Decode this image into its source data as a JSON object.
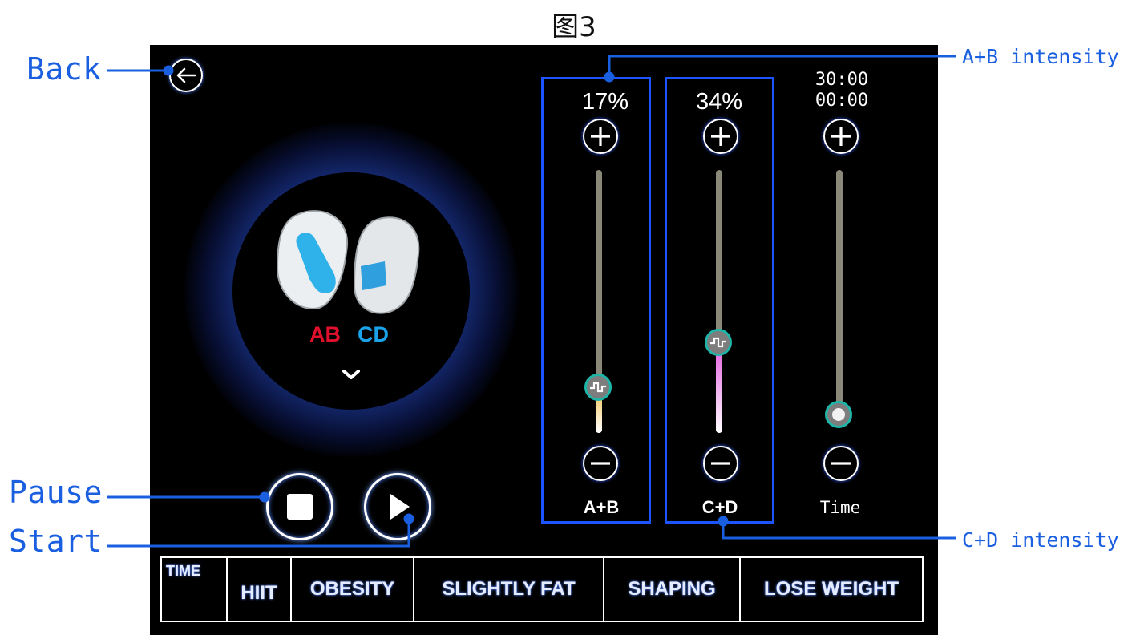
{
  "figure": {
    "title": "图3"
  },
  "annotations": {
    "back": "Back",
    "pause": "Pause",
    "start": "Start",
    "ab_intensity": "A+B intensity",
    "cd_intensity": "C+D intensity",
    "color": "#1a5fe0"
  },
  "screen": {
    "channels": {
      "ab_label": "AB",
      "cd_label": "CD",
      "ab_color": "#e0102c",
      "cd_color": "#1ba3ea"
    },
    "sliders": [
      {
        "id": "ab",
        "label": "A+B",
        "value_text": "17%",
        "value": 0.17,
        "fill_color": "#f0c050"
      },
      {
        "id": "cd",
        "label": "C+D",
        "value_text": "34%",
        "value": 0.34,
        "fill_color": "#e25ce0"
      },
      {
        "id": "time",
        "label": "Time",
        "time_total": "30:00",
        "time_elapsed": "00:00",
        "value": 0.0
      }
    ],
    "programs": [
      "TIME",
      "HIIT",
      "OBESITY",
      "SLIGHTLY FAT",
      "SHAPING",
      "LOSE WEIGHT"
    ]
  }
}
